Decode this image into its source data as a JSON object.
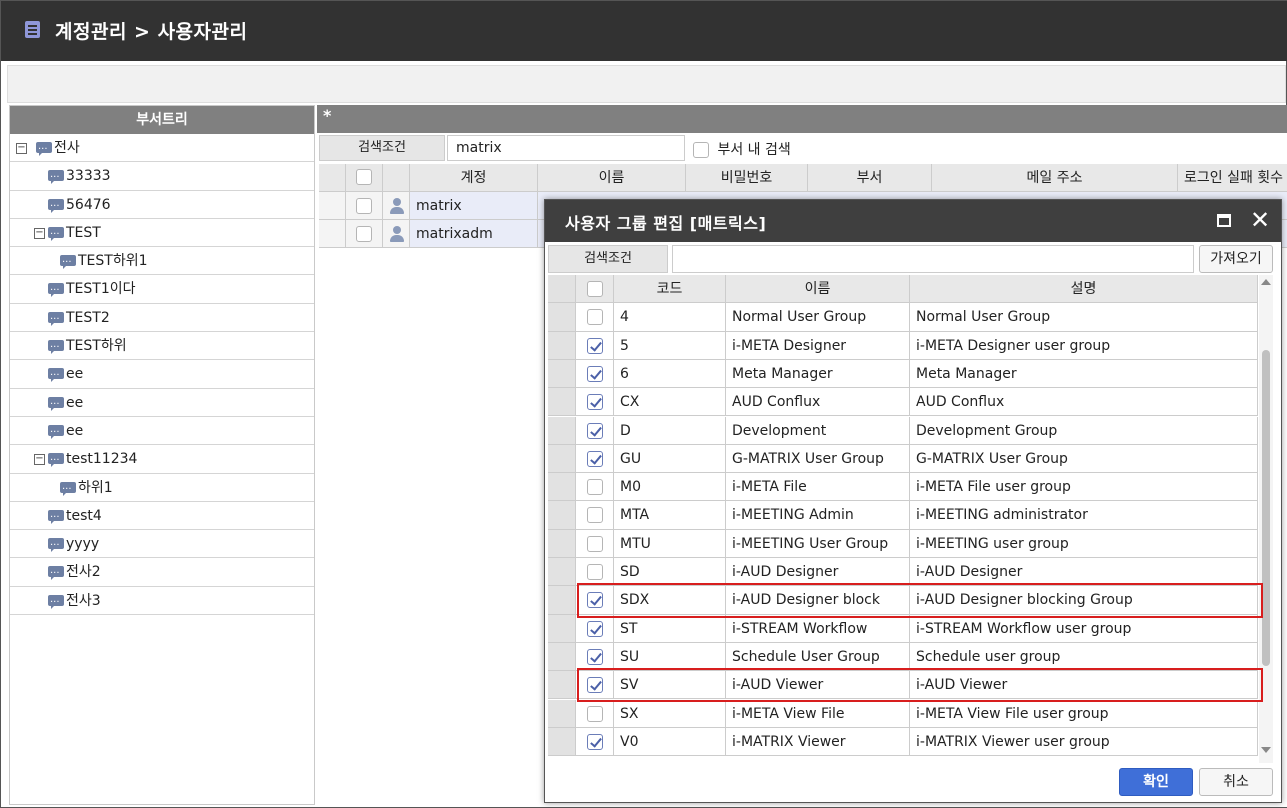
{
  "header": {
    "title": "계정관리 > 사용자관리",
    "icon": "document-list-icon"
  },
  "dept_tree": {
    "title": "부서트리",
    "nodes": [
      {
        "label": "전사",
        "level": 0,
        "expanded": true
      },
      {
        "label": "33333",
        "level": 1
      },
      {
        "label": "56476",
        "level": 1
      },
      {
        "label": "TEST",
        "level": 1,
        "expanded": true
      },
      {
        "label": "TEST하위1",
        "level": 2
      },
      {
        "label": "TEST1이다",
        "level": 1
      },
      {
        "label": "TEST2",
        "level": 1
      },
      {
        "label": "TEST하위",
        "level": 1
      },
      {
        "label": "ee",
        "level": 1
      },
      {
        "label": "ee",
        "level": 1
      },
      {
        "label": "ee",
        "level": 1
      },
      {
        "label": "test11234",
        "level": 1,
        "expanded": true
      },
      {
        "label": "하위1",
        "level": 2
      },
      {
        "label": "test4",
        "level": 1
      },
      {
        "label": "yyyy",
        "level": 1
      },
      {
        "label": "전사2",
        "level": 1
      },
      {
        "label": "전사3",
        "level": 1
      }
    ]
  },
  "main": {
    "header_mark": "*",
    "search_label": "검색조건",
    "search_value": "matrix",
    "dept_search_label": "부서 내 검색",
    "dept_search_checked": false,
    "columns": [
      "계정",
      "이름",
      "비밀번호",
      "부서",
      "메일 주소",
      "로그인 실패 횟수"
    ],
    "rows": [
      {
        "account": "matrix",
        "checked": false
      },
      {
        "account": "matrixadm",
        "checked": false
      }
    ]
  },
  "dialog": {
    "title": "사용자 그룹 편집 [매트릭스]",
    "search_label": "검색조건",
    "search_value": "",
    "fetch_label": "가져오기",
    "columns": [
      "코드",
      "이름",
      "설명"
    ],
    "rows": [
      {
        "code": "4",
        "name": "Normal User Group",
        "desc": "Normal User Group",
        "checked": false
      },
      {
        "code": "5",
        "name": "i-META Designer",
        "desc": "i-META Designer user group",
        "checked": true
      },
      {
        "code": "6",
        "name": "Meta Manager",
        "desc": "Meta Manager",
        "checked": true
      },
      {
        "code": "CX",
        "name": "AUD Conflux",
        "desc": "AUD Conflux",
        "checked": true
      },
      {
        "code": "D",
        "name": "Development",
        "desc": "Development Group",
        "checked": true
      },
      {
        "code": "GU",
        "name": "G-MATRIX User Group",
        "desc": "G-MATRIX User Group",
        "checked": true
      },
      {
        "code": "M0",
        "name": "i-META File",
        "desc": "i-META File user group",
        "checked": false
      },
      {
        "code": "MTA",
        "name": "i-MEETING Admin",
        "desc": "i-MEETING administrator",
        "checked": false
      },
      {
        "code": "MTU",
        "name": "i-MEETING User Group",
        "desc": "i-MEETING user group",
        "checked": false
      },
      {
        "code": "SD",
        "name": "i-AUD Designer",
        "desc": "i-AUD Designer",
        "checked": false
      },
      {
        "code": "SDX",
        "name": "i-AUD Designer block",
        "desc": "i-AUD Designer blocking Group",
        "checked": true,
        "highlighted": true
      },
      {
        "code": "ST",
        "name": "i-STREAM Workflow",
        "desc": "i-STREAM Workflow user group",
        "checked": true
      },
      {
        "code": "SU",
        "name": "Schedule User Group",
        "desc": "Schedule user group",
        "checked": true
      },
      {
        "code": "SV",
        "name": "i-AUD Viewer",
        "desc": "i-AUD Viewer",
        "checked": true,
        "highlighted": true
      },
      {
        "code": "SX",
        "name": "i-META View File",
        "desc": "i-META View File user group",
        "checked": false
      },
      {
        "code": "V0",
        "name": "i-MATRIX Viewer",
        "desc": "i-MATRIX Viewer user group",
        "checked": true
      }
    ],
    "ok_label": "확인",
    "cancel_label": "취소",
    "highlight_color": "#d81e1e",
    "ok_color": "#3f6fd8"
  }
}
